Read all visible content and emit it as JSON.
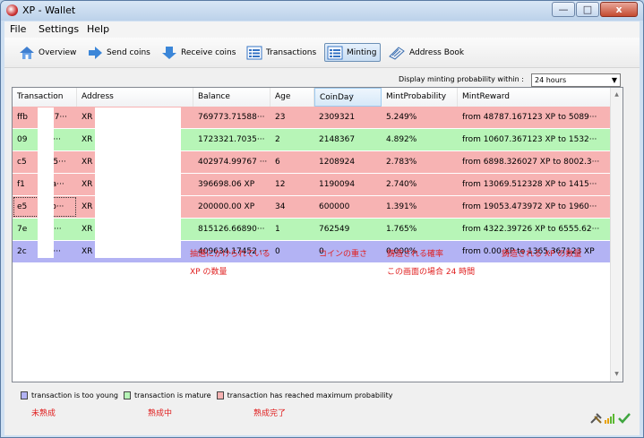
{
  "window": {
    "title": "XP - Wallet",
    "min_glyph": "—",
    "max_glyph": "□",
    "close_glyph": "x"
  },
  "menu": [
    "File",
    "Settings",
    "Help"
  ],
  "toolbar": {
    "overview": "Overview",
    "send": "Send coins",
    "receive": "Receive coins",
    "transactions": "Transactions",
    "minting": "Minting",
    "address_book": "Address Book"
  },
  "filter": {
    "label": "Display minting probability within :",
    "value": "24 hours"
  },
  "table": {
    "headers": [
      "Transaction",
      "Address",
      "Balance",
      "Age",
      "CoinDay",
      "MintProbability",
      "MintReward"
    ],
    "rows": [
      {
        "status": "maxp",
        "tx": "ffb",
        "tx_tail": "97···",
        "addr": "XR",
        "balance": "769773.71588···",
        "age": "23",
        "coinday": "2309321",
        "prob": "5.249%",
        "reward": "from  48787.167123 XP to 5089···"
      },
      {
        "status": "mature",
        "tx": "09",
        "tx_tail": "c···",
        "addr": "XR",
        "balance": "1723321.7035···",
        "age": "2",
        "coinday": "2148367",
        "prob": "4.892%",
        "reward": "from  10607.367123 XP to 1532···"
      },
      {
        "status": "maxp",
        "tx": "c5",
        "tx_tail": "05···",
        "addr": "XR",
        "balance": "402974.99767 ···",
        "age": "6",
        "coinday": "1208924",
        "prob": "2.783%",
        "reward": "from  6898.326027 XP to 8002.3···"
      },
      {
        "status": "maxp",
        "tx": "f1",
        "tx_tail": "9a···",
        "addr": "XR",
        "balance": "396698.06 XP",
        "age": "12",
        "coinday": "1190094",
        "prob": "2.740%",
        "reward": "from  13069.512328 XP to 1415···"
      },
      {
        "status": "maxp",
        "tx": "e5",
        "tx_tail": ".b···",
        "addr": "XR",
        "balance": "200000.00 XP",
        "age": "34",
        "coinday": "600000",
        "prob": "1.391%",
        "reward": "from  19053.473972 XP to 1960···"
      },
      {
        "status": "mature",
        "tx": "7e",
        "tx_tail": "d···",
        "addr": "XR",
        "balance": "815126.66890···",
        "age": "1",
        "coinday": "762549",
        "prob": "1.765%",
        "reward": "from  4322.39726 XP to 6555.62···"
      },
      {
        "status": "young",
        "tx": "2c",
        "tx_tail": "1···",
        "addr": "XR",
        "balance": "409634.17452 ···",
        "age": "0",
        "coinday": "0",
        "prob": "0.000%",
        "reward": "from  0.00 XP to 1365.367123 XP"
      }
    ]
  },
  "annotations": {
    "balance_1": "抽選にかけられている",
    "balance_2": "XP の数量",
    "coinday": "コインの重さ",
    "prob_1": "鋳造される確率",
    "prob_2": "この画面の場合 24 時間",
    "reward": "鋳造される XP の数量"
  },
  "legend": {
    "young": "transaction is too young",
    "mature": "transaction is mature",
    "maxp": "transaction has reached maximum probability",
    "young_jp": "未熟成",
    "mature_jp": "熟成中",
    "maxp_jp": "熟成完了"
  },
  "colors": {
    "young": "#b3b3f4",
    "mature": "#b7f5b7",
    "maxp": "#f7b3b3",
    "annotation": "#e02020"
  }
}
